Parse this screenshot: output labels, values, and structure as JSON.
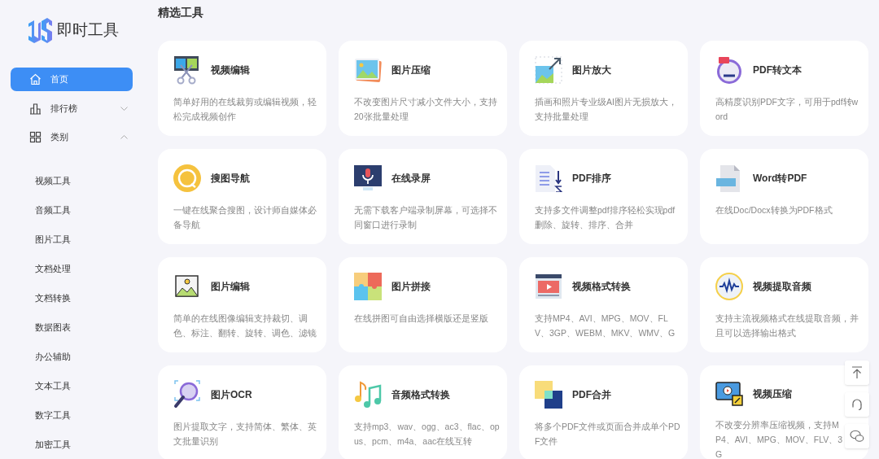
{
  "sidebar": {
    "logo_text": "即时工具",
    "nav": [
      {
        "label": "首页",
        "selected": true
      },
      {
        "label": "排行榜",
        "selected": false,
        "expanded": false
      },
      {
        "label": "类别",
        "selected": false,
        "expanded": true,
        "children": [
          {
            "label": "视频工具"
          },
          {
            "label": "音频工具"
          },
          {
            "label": "图片工具"
          },
          {
            "label": "文档处理"
          },
          {
            "label": "文档转换"
          },
          {
            "label": "数据图表"
          },
          {
            "label": "办公辅助"
          },
          {
            "label": "文本工具"
          },
          {
            "label": "数字工具"
          },
          {
            "label": "加密工具"
          }
        ]
      }
    ]
  },
  "section_title": "精选工具",
  "tools": [
    {
      "title": "视频编辑",
      "description": "简单好用的在线裁剪或编辑视频，轻松完成视频创作"
    },
    {
      "title": "图片压缩",
      "description": "不改变图片尺寸减小文件大小，支持20张批量处理"
    },
    {
      "title": "图片放大",
      "description": "插画和照片专业级AI图片无损放大，支持批量处理"
    },
    {
      "title": "PDF转文本",
      "description": "高精度识别PDF文字，可用于pdf转word"
    },
    {
      "title": "搜图导航",
      "description": "一键在线聚合搜图，设计师自媒体必备导航"
    },
    {
      "title": "在线录屏",
      "description": "无需下载客户端录制屏幕，可选择不同窗口进行录制"
    },
    {
      "title": "PDF排序",
      "description": "支持多文件调整pdf排序轻松实现pdf删除、旋转、排序、合并"
    },
    {
      "title": "Word转PDF",
      "description": "在线Doc/Docx转换为PDF格式"
    },
    {
      "title": "图片编辑",
      "description": "简单的在线图像编辑支持裁切、调色、标注、翻转、旋转、调色、滤镜"
    },
    {
      "title": "图片拼接",
      "description": "在线拼图可自由选择横版还是竖版"
    },
    {
      "title": "视频格式转换",
      "description": "支持MP4、AVI、MPG、MOV、FLV、3GP、WEBM、MKV、WMV、G"
    },
    {
      "title": "视频提取音频",
      "description": "支持主流视频格式在线提取音频，并且可以选择输出格式"
    },
    {
      "title": "图片OCR",
      "description": "图片提取文字，支持简体、繁体、英文批量识别"
    },
    {
      "title": "音频格式转换",
      "description": "支持mp3、wav、ogg、ac3、flac、opus、pcm、m4a、aac在线互转"
    },
    {
      "title": "PDF合并",
      "description": "将多个PDF文件或页面合并成单个PDF文件"
    },
    {
      "title": "视频压缩",
      "description": "不改变分辨率压缩视频，支持MP4、AVI、MPG、MOV、FLV、3G"
    }
  ]
}
